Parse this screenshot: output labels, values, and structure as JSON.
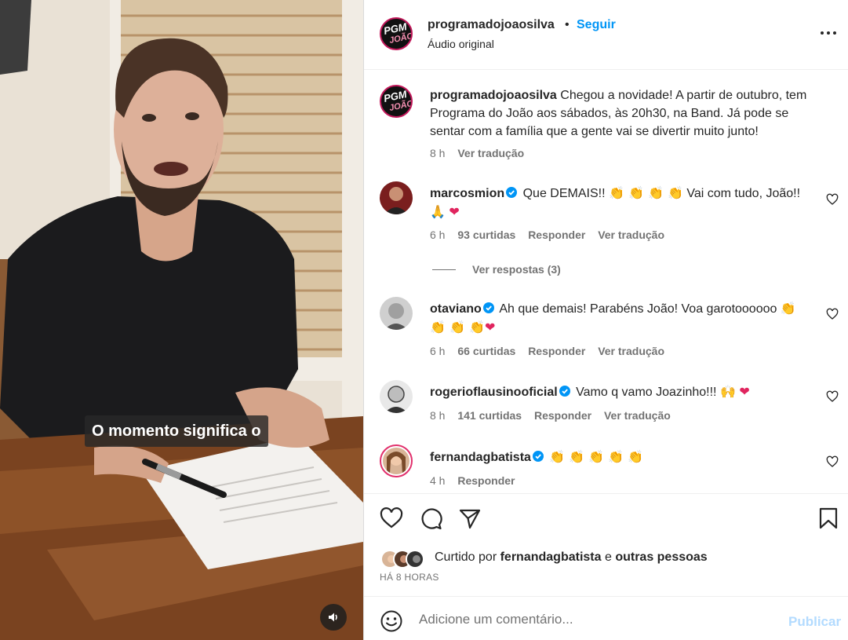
{
  "post": {
    "username": "programadojoaosilva",
    "dot": "•",
    "follow_label": "Seguir",
    "audio": "Áudio original",
    "more_icon": "more-horizontal-icon",
    "avatar_text_top": "PGM",
    "avatar_text_bottom": "JOÃO",
    "caption_username": "programadojoaosilva",
    "caption_text": "Chegou a novidade! A partir de outubro, tem Programa do João aos sábados, às 20h30, na Band. Já pode se sentar com a família que a gente vai se divertir muito junto!",
    "caption_time": "8 h",
    "caption_translate": "Ver tradução"
  },
  "video": {
    "subtitle": "O momento significa o",
    "sound_icon": "speaker-icon"
  },
  "comments": [
    {
      "username": "marcosmion",
      "verified": true,
      "text_before": "Que DEMAIS!! ",
      "claps": "👏 👏 👏 👏",
      "text_after": " Vai com tudo, João!! ",
      "hands": "🙏",
      "heart": "❤",
      "time": "6 h",
      "likes": "93 curtidas",
      "reply": "Responder",
      "translate": "Ver tradução",
      "view_replies": "Ver respostas (3)"
    },
    {
      "username": "otaviano",
      "verified": true,
      "text_before": "Ah que demais! Parabéns João! Voa garotoooooo ",
      "claps": "👏 👏 👏 👏",
      "heart": "❤",
      "time": "6 h",
      "likes": "66 curtidas",
      "reply": "Responder",
      "translate": "Ver tradução"
    },
    {
      "username": "rogerioflausinooficial",
      "verified": true,
      "text_before": "Vamo q vamo Joazinho!!! ",
      "hands": "🙌",
      "heart": "❤",
      "time": "8 h",
      "likes": "141 curtidas",
      "reply": "Responder",
      "translate": "Ver tradução"
    },
    {
      "username": "fernandagbatista",
      "verified": true,
      "claps": "👏 👏 👏 👏 👏",
      "time": "4 h",
      "reply": "Responder"
    }
  ],
  "actions": {
    "like_icon": "heart-icon",
    "comment_icon": "comment-icon",
    "share_icon": "send-icon",
    "save_icon": "bookmark-icon",
    "liked_by_prefix": "Curtido por ",
    "liked_by_user": "fernandagbatista",
    "liked_by_join": " e ",
    "liked_by_others": "outras pessoas",
    "time_ago": "HÁ 8 HORAS"
  },
  "comment_box": {
    "placeholder": "Adicione um comentário...",
    "publish_label": "Publicar",
    "emoji_icon": "emoji-icon"
  },
  "colors": {
    "accent": "#0095f6",
    "publish_disabled": "#b3dbff",
    "muted": "#737373",
    "verified": "#0095f6"
  }
}
